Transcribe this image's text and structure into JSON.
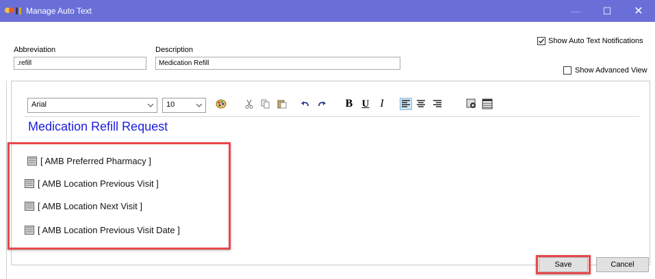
{
  "window": {
    "title": "Manage Auto Text",
    "minimize_symbol": "—",
    "maximize_symbol": "☐",
    "close_symbol": "✕"
  },
  "form": {
    "abbreviation_label": "Abbreviation",
    "abbreviation_value": ".refill",
    "description_label": "Description",
    "description_value": "Medication Refill",
    "show_notifications_label": "Show Auto Text Notifications",
    "show_notifications_checked": true,
    "show_advanced_label": "Show Advanced View",
    "show_advanced_checked": false
  },
  "toolbar": {
    "font_name": "Arial",
    "font_size": "10",
    "icons": [
      "color-palette-icon",
      "cut-icon",
      "copy-icon",
      "paste-icon",
      "undo-icon",
      "redo-icon",
      "bold-icon",
      "underline-icon",
      "italic-icon",
      "align-left-icon",
      "align-center-icon",
      "align-right-icon",
      "insert-field-icon",
      "table-icon"
    ],
    "bold_glyph": "B",
    "underline_glyph": "U",
    "italic_glyph": "I"
  },
  "editor": {
    "heading": "Medication Refill Request",
    "fields": [
      "[ AMB Preferred Pharmacy ]",
      "[ AMB Location Previous Visit ]",
      "[ AMB Location Next Visit ]",
      "[ AMB Location Previous Visit Date ]"
    ]
  },
  "buttons": {
    "save": "Save",
    "cancel": "Cancel"
  },
  "colors": {
    "titlebar": "#6a6fd8",
    "heading": "#1c1cdd",
    "callout": "#e8474b"
  }
}
